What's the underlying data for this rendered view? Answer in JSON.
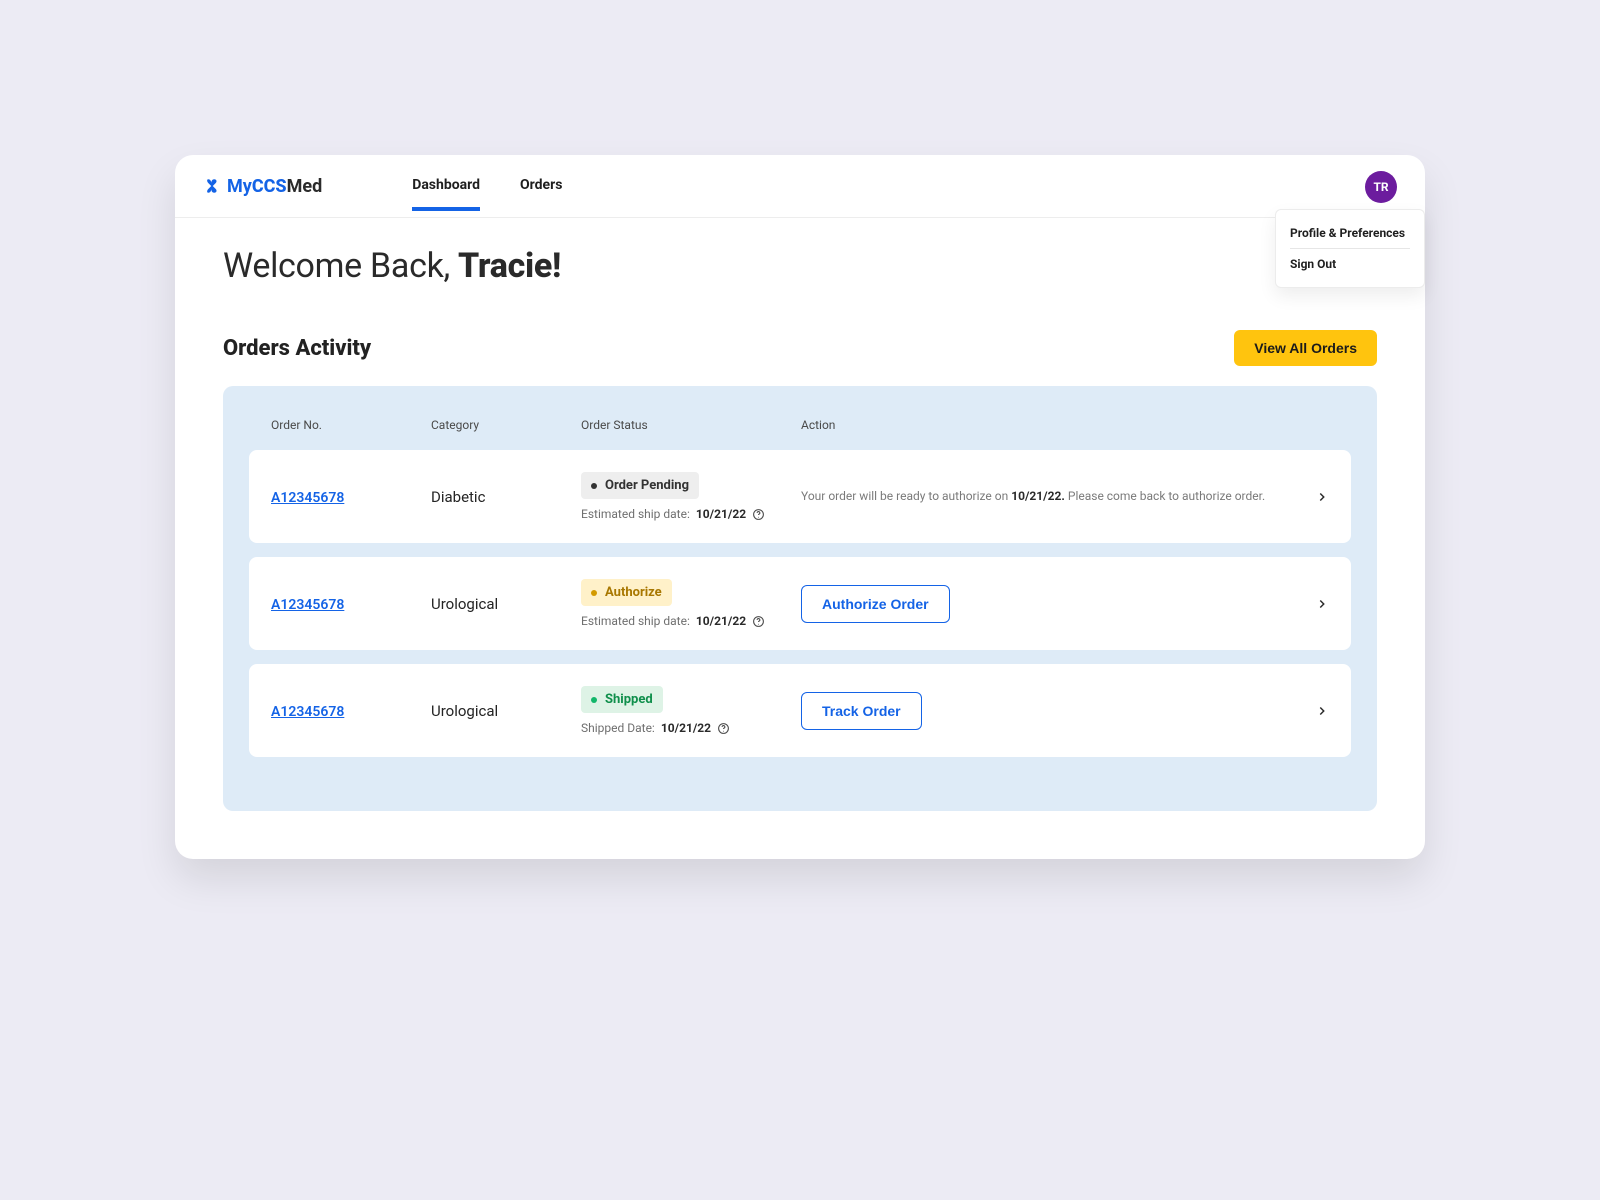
{
  "brand": {
    "my": "My",
    "ccs": "CCS",
    "med": "Med"
  },
  "tabs": [
    {
      "label": "Dashboard",
      "active": true
    },
    {
      "label": "Orders",
      "active": false
    }
  ],
  "avatar": "TR",
  "dropdown": {
    "items": [
      {
        "label": "Profile & Preferences"
      },
      {
        "label": "Sign Out"
      }
    ]
  },
  "welcome": {
    "prefix": "Welcome Back, ",
    "name": "Tracie!"
  },
  "orders_section": {
    "title": "Orders Activity",
    "view_all": "View All Orders",
    "columns": [
      "Order No.",
      "Category",
      "Order Status",
      "Action"
    ],
    "rows": [
      {
        "order_no": "A12345678",
        "category": "Diabetic",
        "status": {
          "label": "Order Pending",
          "variant": "grey"
        },
        "ship_label": "Estimated ship date: ",
        "ship_date": "10/21/22",
        "action_note_pre": "Your order will be ready to authorize on ",
        "action_note_date": "10/21/22.",
        "action_note_post": " Please come back to authorize order.",
        "button": null
      },
      {
        "order_no": "A12345678",
        "category": "Urological",
        "status": {
          "label": "Authorize",
          "variant": "amber"
        },
        "ship_label": "Estimated ship date: ",
        "ship_date": "10/21/22",
        "button": "Authorize Order"
      },
      {
        "order_no": "A12345678",
        "category": "Urological",
        "status": {
          "label": "Shipped",
          "variant": "green"
        },
        "ship_label": "Shipped Date: ",
        "ship_date": "10/21/22",
        "button": "Track Order"
      }
    ]
  }
}
